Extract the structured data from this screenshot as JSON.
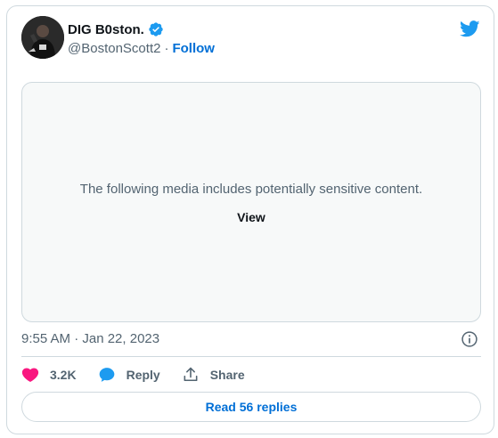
{
  "tweet": {
    "author_name": "DIG B0ston.",
    "handle": "@BostonScott2",
    "separator": "·",
    "follow_label": "Follow",
    "media_warning": "The following media includes potentially sensitive content.",
    "view_label": "View",
    "timestamp": "9:55 AM · Jan 22, 2023",
    "actions": {
      "likes_count": "3.2K",
      "reply_label": "Reply",
      "share_label": "Share"
    },
    "read_replies_label": "Read 56 replies"
  },
  "colors": {
    "accent_blue": "#006fd6",
    "twitter_blue": "#1d9bf0",
    "like_pink": "#f91880",
    "muted_text": "#536471",
    "border": "#cfd9de",
    "media_bg": "#f7f9f9"
  },
  "icons": {
    "verified": "verified-badge-icon",
    "logo": "twitter-bird-icon",
    "info": "info-icon",
    "like": "heart-icon",
    "reply": "speech-bubble-icon",
    "share": "share-upload-icon"
  }
}
